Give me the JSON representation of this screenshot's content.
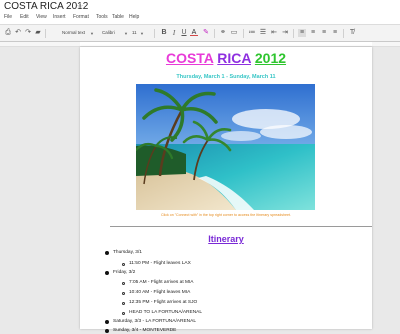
{
  "document": {
    "title": "COSTA RICA 2012",
    "star_icon": "star-outline-icon"
  },
  "menu": [
    "File",
    "Edit",
    "View",
    "Insert",
    "Format",
    "Tools",
    "Table",
    "Help"
  ],
  "toolbar": {
    "style_value": "Normal text",
    "font_value": "Calibri",
    "size_value": "11",
    "icons": [
      "print-icon",
      "undo-icon",
      "redo-icon",
      "paint-format-icon",
      "bold-icon",
      "italic-icon",
      "underline-icon",
      "text-color-icon",
      "highlight-color-icon",
      "link-icon",
      "comment-icon",
      "numbered-list-icon",
      "bulleted-list-icon",
      "indent-less-icon",
      "indent-more-icon",
      "align-left-icon",
      "align-center-icon",
      "align-right-icon",
      "justify-icon",
      "clear-formatting-icon"
    ]
  },
  "content": {
    "heading_words": [
      {
        "text": "COSTA",
        "color": "#e83ad8"
      },
      {
        "text": "RICA",
        "color": "#8e2fe0"
      },
      {
        "text": "2012",
        "color": "#2ec52e"
      }
    ],
    "dates": "Thursday, March 1 - Sunday, March 11",
    "photo_caption": "Click on \"Connect with\" in the top right corner to access the Itinerary spreadsheet.",
    "itinerary_title": "Itinerary",
    "items": [
      {
        "level": 1,
        "text": "Thursday, 3/1"
      },
      {
        "level": 2,
        "text": "11:50 PM - Flight leaves LAX"
      },
      {
        "level": 1,
        "text": "Friday, 3/2"
      },
      {
        "level": 2,
        "text": "7:05 AM - Flight arrives at MIA"
      },
      {
        "level": 2,
        "text": "10:40 AM - Flight leaves MIA"
      },
      {
        "level": 2,
        "text": "12:35 PM - Flight arrives at SJO"
      },
      {
        "level": 2,
        "text": "HEAD TO LA FORTUNA/ARENAL"
      },
      {
        "level": 1,
        "text": "Saturday, 3/3 - LA FORTUNA/ARENAL"
      },
      {
        "level": 1,
        "text": "Sunday, 3/4 - MONTEVERDE"
      }
    ]
  }
}
